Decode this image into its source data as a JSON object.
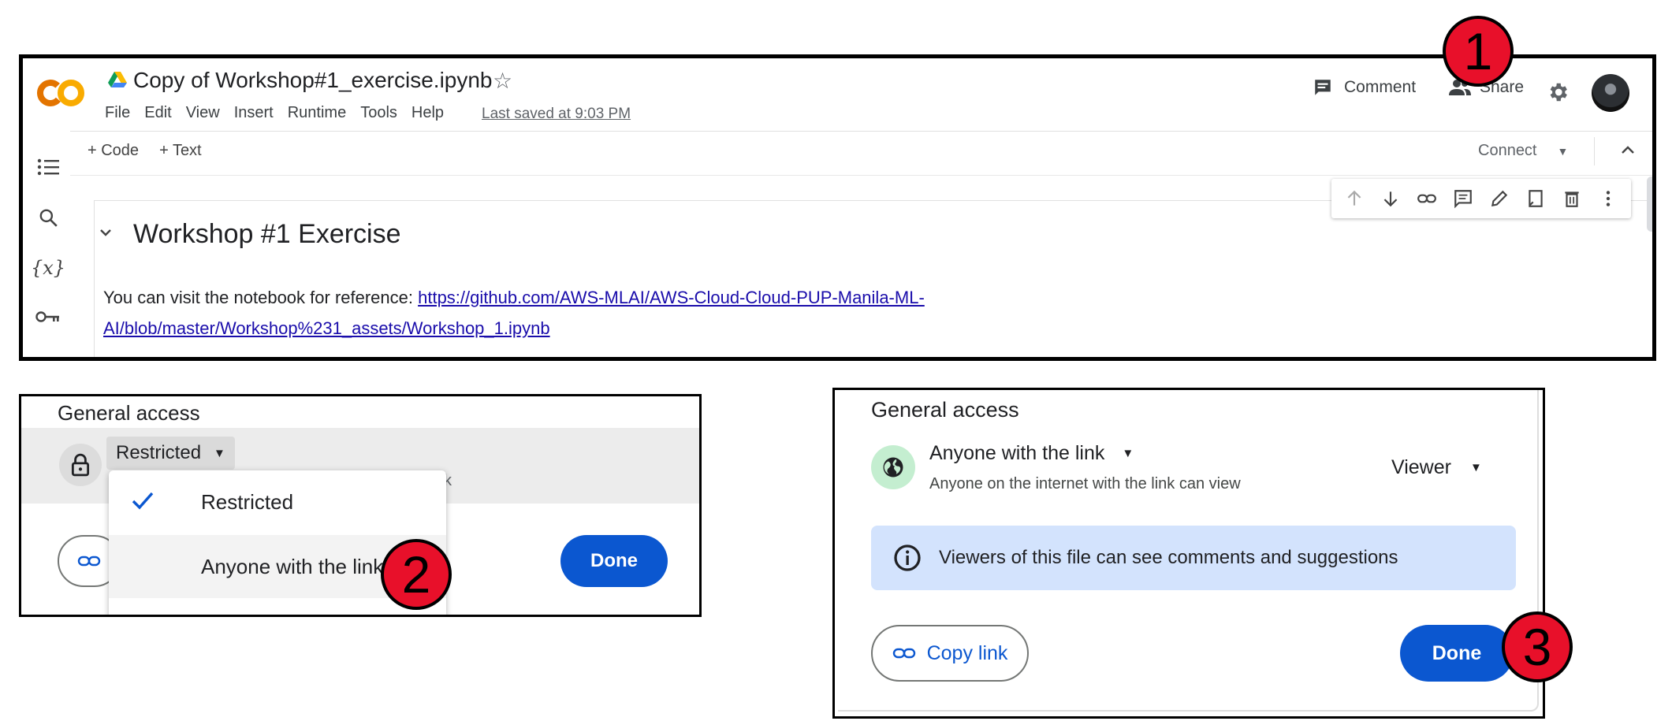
{
  "colab": {
    "logo_text": "CO",
    "notebook_title": "Copy of Workshop#1_exercise.ipynb",
    "menu": [
      "File",
      "Edit",
      "View",
      "Insert",
      "Runtime",
      "Tools",
      "Help"
    ],
    "last_saved": "Last saved at 9:03 PM",
    "comment_label": "Comment",
    "share_label": "Share",
    "add_code": "+ Code",
    "add_text": "+ Text",
    "connect_label": "Connect",
    "cell_heading": "Workshop #1 Exercise",
    "cell_text_prefix": "You can visit the notebook for reference: ",
    "cell_link_line1": "https://github.com/AWS-MLAI/AWS-Cloud-Cloud-PUP-Manila-ML-",
    "cell_link_line2": "AI/blob/master/Workshop%231_assets/Workshop_1.ipynb"
  },
  "steps": [
    "1",
    "2",
    "3"
  ],
  "panel_restricted": {
    "section_title": "General access",
    "access_button": "Restricted",
    "hidden_subtext_fragment": "k",
    "dropdown_options": [
      {
        "label": "Restricted",
        "selected": true
      },
      {
        "label": "Anyone with the link",
        "selected": false
      }
    ],
    "done_label": "Done"
  },
  "panel_anyone": {
    "section_title": "General access",
    "access_label": "Anyone with the link",
    "access_description": "Anyone on the internet with the link can view",
    "role_label": "Viewer",
    "info_text": "Viewers of this file can see comments and suggestions",
    "copy_link_label": "Copy link",
    "done_label": "Done"
  },
  "colors": {
    "accent_blue": "#0b57d0",
    "info_bg": "#d3e3fd",
    "step_red": "#e8102a",
    "colab_orange": "#f9ab00",
    "colab_orange_dark": "#e37400"
  }
}
